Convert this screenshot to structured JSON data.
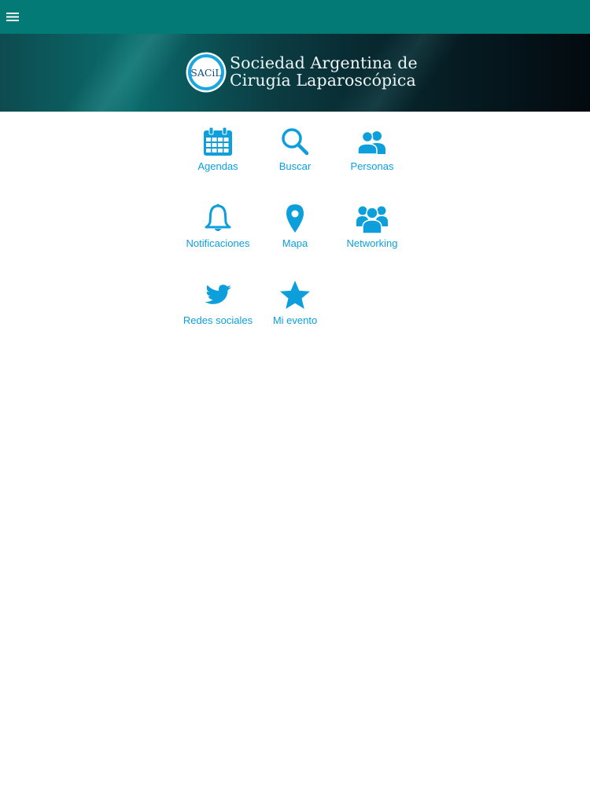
{
  "header": {
    "menu_icon": "hamburger-menu-icon",
    "bar_color": "#037a76"
  },
  "banner": {
    "logo_text": "SACiL",
    "title_line1": "Sociedad Argentina de",
    "title_line2": "Cirugía Laparoscópica"
  },
  "accent_color": "#0c9fdc",
  "tiles": [
    {
      "label": "Agendas",
      "icon": "calendar-icon"
    },
    {
      "label": "Buscar",
      "icon": "search-icon"
    },
    {
      "label": "Personas",
      "icon": "people-icon"
    },
    {
      "label": "Notificaciones",
      "icon": "bell-icon"
    },
    {
      "label": "Mapa",
      "icon": "map-pin-icon"
    },
    {
      "label": "Networking",
      "icon": "group-icon"
    },
    {
      "label": "Redes sociales",
      "icon": "twitter-bird-icon"
    },
    {
      "label": "Mi evento",
      "icon": "star-icon"
    }
  ]
}
